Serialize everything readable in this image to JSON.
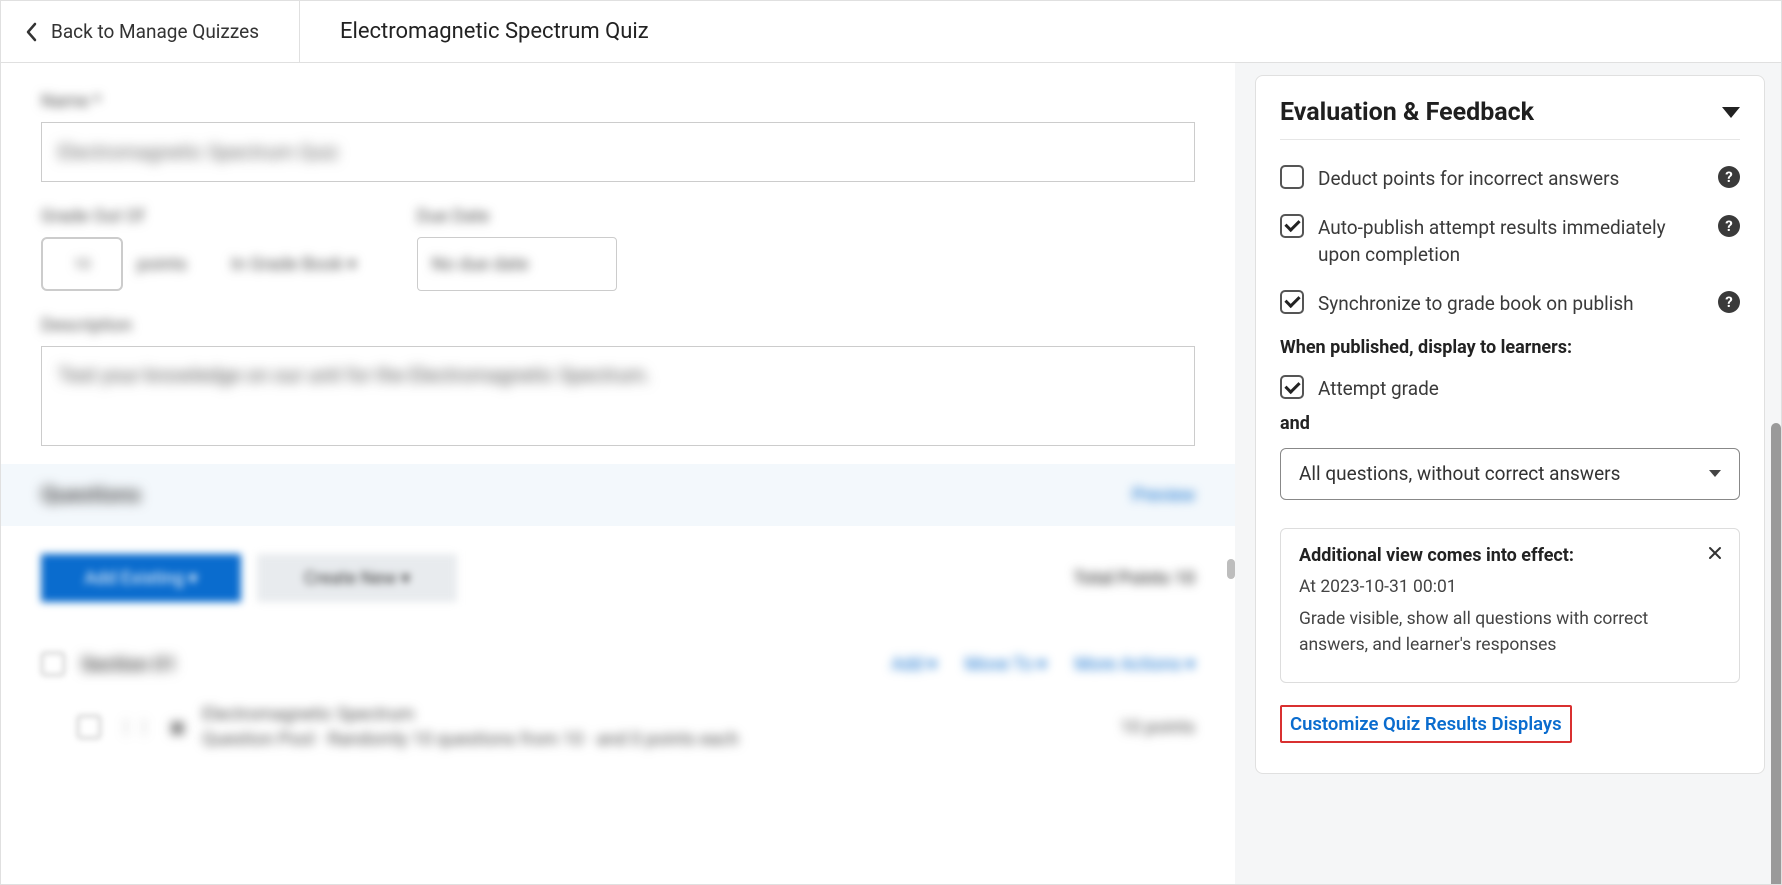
{
  "header": {
    "back_label": "Back to Manage Quizzes",
    "title": "Electromagnetic Spectrum Quiz"
  },
  "left": {
    "label_name": "Name *",
    "name_value": "Electromagnetic Spectrum Quiz",
    "label_grade": "Grade Out Of",
    "grade_value": "10",
    "grade_suffix": "points",
    "grade_link": "In Grade Book ▾",
    "label_due": "Due Date",
    "due_placeholder": "No due date",
    "label_description": "Description",
    "description_text": "Test your knowledge on our unit for the Electromagnetic Spectrum.",
    "section_heading": "Questions",
    "preview_label": "Preview",
    "btn_add": "Add Existing ▾",
    "btn_create": "Create New ▾",
    "total_points": "Total Points 10",
    "row1_label": "Section 01",
    "row1_link1": "Add ▾",
    "row1_link2": "Move To ▾",
    "row1_link3": "More Actions ▾",
    "row2_title": "Electromagnetic Spectrum",
    "row2_sub": "Question Pool · Randomly 10 questions from 10 · and 0 points each",
    "row2_pts": "10 points"
  },
  "panel": {
    "title": "Evaluation & Feedback",
    "cb_deduct": "Deduct points for incorrect answers",
    "cb_autopub": "Auto-publish attempt results immediately upon completion",
    "cb_sync": "Synchronize to grade book on publish",
    "subhead_display": "When published, display to learners:",
    "cb_attempt": "Attempt grade",
    "and_label": "and",
    "select_value": "All questions, without correct answers",
    "info_title": "Additional view comes into effect:",
    "info_date": "At 2023-10-31 00:01",
    "info_detail": "Grade visible, show all questions with correct answers, and learner's responses",
    "customize_link": "Customize Quiz Results Displays"
  }
}
